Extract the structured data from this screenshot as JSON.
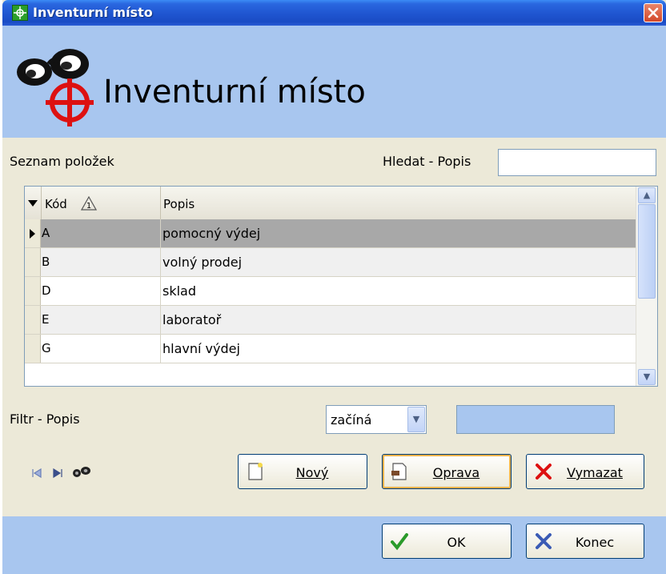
{
  "window": {
    "title": "Inventurní místo",
    "header_title": "Inventurní místo"
  },
  "list": {
    "label": "Seznam položek",
    "search_label": "Hledat - Popis",
    "search_value": "",
    "columns": [
      {
        "label": "Kód"
      },
      {
        "label": "Popis"
      }
    ],
    "rows": [
      {
        "kod": "A",
        "popis": "pomocný výdej",
        "selected": true
      },
      {
        "kod": "B",
        "popis": "volný prodej"
      },
      {
        "kod": "D",
        "popis": "sklad"
      },
      {
        "kod": "E",
        "popis": "laboratoř"
      },
      {
        "kod": "G",
        "popis": "hlavní výdej"
      }
    ]
  },
  "filter": {
    "label": "Filtr - Popis",
    "mode": "začíná",
    "value": ""
  },
  "actions": {
    "new_label": "Nový",
    "edit_label": "Oprava",
    "delete_label": "Vymazat"
  },
  "footer": {
    "ok_label": "OK",
    "close_label": "Konec"
  },
  "icons": {
    "title": "app-icon",
    "logo": "binoculars-target-icon",
    "first": "first-record-icon",
    "last": "last-record-icon",
    "find": "binoculars-icon",
    "sort": "sort-indicator-icon"
  },
  "colors": {
    "header_bg": "#a8c6ef",
    "selected_row": "#a8a8a8",
    "titlebar": "#2a67e0"
  }
}
